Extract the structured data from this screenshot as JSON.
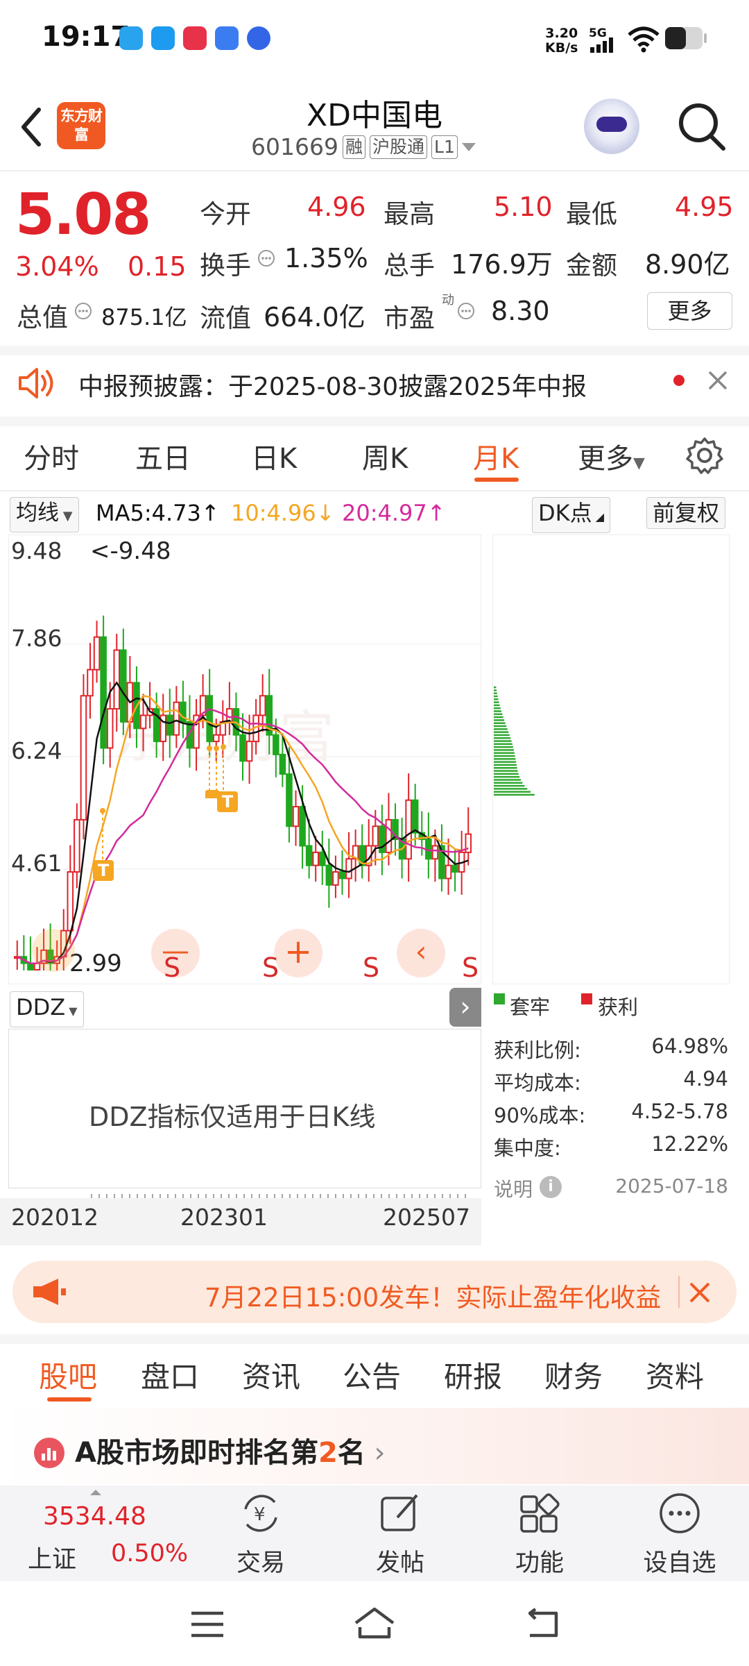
{
  "status": {
    "time": "19:17",
    "net_speed": "3.20",
    "net_unit": "KB/s",
    "network": "5G"
  },
  "header": {
    "logo": "东方财富",
    "title": "XD中国电",
    "code": "601669",
    "tags": [
      "融",
      "沪股通",
      "L1"
    ]
  },
  "quote": {
    "price": "5.08",
    "change_pct": "3.04%",
    "change": "0.15",
    "total_value_label": "总值",
    "total_value": "875.1亿",
    "open_label": "今开",
    "open": "4.96",
    "high_label": "最高",
    "high": "5.10",
    "low_label": "最低",
    "low": "4.95",
    "turnover_label": "换手",
    "turnover": "1.35%",
    "volume_label": "总手",
    "volume": "176.9万",
    "amount_label": "金额",
    "amount": "8.90亿",
    "float_label": "流值",
    "float_value": "664.0亿",
    "pe_label": "市盈",
    "pe_sup": "动",
    "pe": "8.30",
    "more_btn": "更多"
  },
  "notice": {
    "text": "中报预披露：于2025-08-30披露2025年中报"
  },
  "chart_tabs": [
    "分时",
    "五日",
    "日K",
    "周K",
    "月K",
    "更多"
  ],
  "active_chart_tab": "月K",
  "chart": {
    "ma_select": "均线",
    "ma5": "MA5:4.73↑",
    "ma10": "10:4.96↓",
    "ma20": "20:4.97↑",
    "dk_btn": "DK点",
    "fq_btn": "前复权",
    "price_labels": [
      "9.48",
      "7.86",
      "6.24",
      "4.61",
      "2.99"
    ],
    "max_marker": "<-9.48",
    "min_marker": "2.99",
    "sell_marks": [
      "S",
      "S",
      "S",
      "S"
    ],
    "buy_marks": [
      "T",
      "T"
    ],
    "indicator": "DDZ",
    "indicator_msg": "DDZ指标仅适用于日K线",
    "dates": [
      "202012",
      "202301",
      "202507"
    ],
    "colors": {
      "up": "#e0232a",
      "down": "#1fa81f",
      "ma5": "#111111",
      "ma10": "#f5a623",
      "ma20": "#d42a9c"
    }
  },
  "chip": {
    "legend_trap": "套牢",
    "legend_profit": "获利",
    "stats": [
      {
        "k": "获利比例:",
        "v": "64.98%"
      },
      {
        "k": "平均成本:",
        "v": "4.94"
      },
      {
        "k": "90%成本:",
        "v": "4.52-5.78"
      },
      {
        "k": "集中度:",
        "v": "12.22%"
      }
    ],
    "note": "说明",
    "date": "2025-07-18"
  },
  "banner": {
    "text": "7月22日15:00发车！实际止盈年化收益"
  },
  "bottom_tabs": [
    "股吧",
    "盘口",
    "资讯",
    "公告",
    "研报",
    "财务",
    "资料"
  ],
  "active_bottom_tab": "股吧",
  "rank": {
    "prefix": "A股市场即时排名第",
    "num": "2",
    "suffix": "名"
  },
  "index": {
    "value": "3534.48",
    "name": "上证",
    "pct": "0.50%"
  },
  "nav": [
    "交易",
    "发帖",
    "功能",
    "设自选"
  ]
}
